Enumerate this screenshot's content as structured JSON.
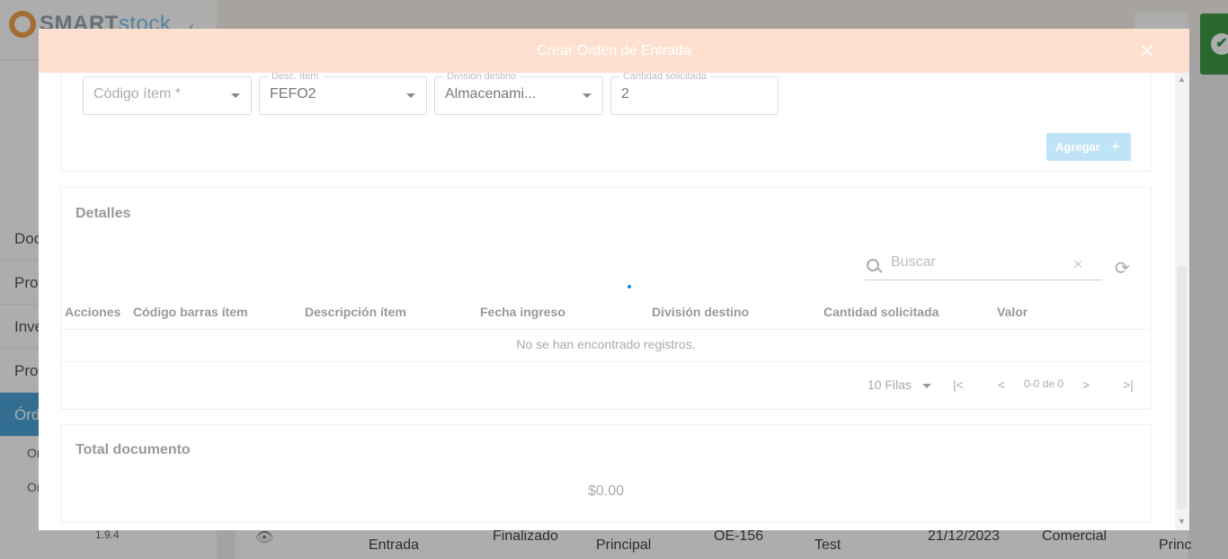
{
  "background": {
    "logo": {
      "brand_a": "SMART",
      "brand_b": "stock"
    },
    "nav": [
      {
        "label": "Doc"
      },
      {
        "label": "Pro"
      },
      {
        "label": "Inve"
      },
      {
        "label": "Pro"
      },
      {
        "label": "Órd"
      }
    ],
    "sub_items": [
      "Or",
      "Or"
    ],
    "version": "1.9.4",
    "row": {
      "type": "Entrada",
      "status": "Finalizado",
      "warehouse": "Principal",
      "code": "OE-156",
      "user": "Test",
      "date": "21/12/2023",
      "category": "Comercial",
      "extra": "Princ"
    }
  },
  "modal": {
    "title": "Crear Orden de Entrada",
    "close_icon": "close-icon",
    "form": {
      "fields": [
        {
          "label": "",
          "value": "Código ítem *",
          "placeholder": true
        },
        {
          "label": "Desc. ítem",
          "value": "FEFO2"
        },
        {
          "label": "División destino",
          "value": "Almacenami..."
        },
        {
          "label": "Cantidad solicitada",
          "value": "2"
        }
      ],
      "add_button": "Agregar",
      "add_icon": "+"
    },
    "details": {
      "title": "Detalles",
      "search_placeholder": "Buscar",
      "columns": [
        "Acciones",
        "Código barras ítem",
        "Descripción ítem",
        "Fecha ingreso",
        "División destino",
        "Cantidad solicitada",
        "Valor"
      ],
      "empty_message": "No se han encontrado registros.",
      "pagination": {
        "rows_per_page": "10 Filas",
        "range": "0-0 de 0"
      }
    },
    "total": {
      "title": "Total documento",
      "value": "$0.00"
    }
  },
  "colors": {
    "header_bg": "#fde0cf",
    "accent": "#4aa3d8",
    "toast": "#3e9a48",
    "add_button": "#bfe3f7"
  }
}
